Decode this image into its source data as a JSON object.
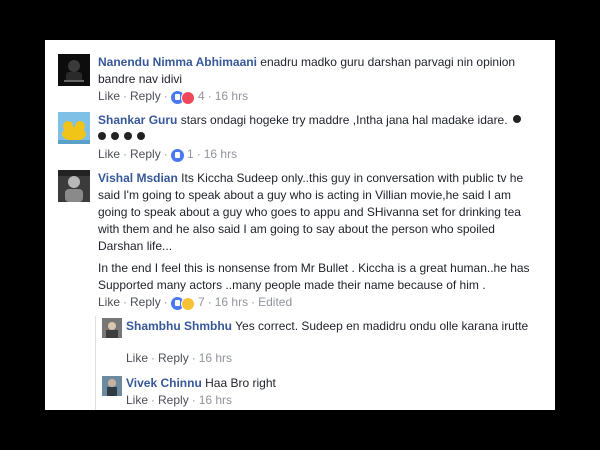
{
  "comments": [
    {
      "author": "Nanendu Nimma Abhimaani",
      "text": "enadru madko guru darshan parvagi nin opinion bandre nav idivi",
      "actions": {
        "like": "Like",
        "reply": "Reply",
        "reactions": "4",
        "time": "16 hrs"
      },
      "reaction_icons": [
        "like-icon",
        "love-icon"
      ]
    },
    {
      "author": "Shankar Guru",
      "text": "stars ondagi hogeke try maddre ,Intha jana hal madake idare.",
      "actions": {
        "like": "Like",
        "reply": "Reply",
        "reactions": "1",
        "time": "16 hrs"
      },
      "reaction_icons": [
        "like-icon"
      ]
    },
    {
      "author": "Vishal Msdian",
      "text": "Its Kiccha Sudeep only..this guy in conversation with public tv he said I'm going to speak about a guy who is acting in Villian movie,he said I am going to speak about a guy who goes to appu and SHivanna set for drinking tea with them and he also said I am going to say about the person who spoiled Darshan life...",
      "text2": "In the end I feel this is nonsense from Mr Bullet . Kiccha is a great human..he has Supported many actors ..many people made their name because of him .",
      "actions": {
        "like": "Like",
        "reply": "Reply",
        "reactions": "7",
        "time": "16 hrs",
        "edited": "Edited"
      },
      "reaction_icons": [
        "like-icon",
        "haha-icon"
      ]
    }
  ],
  "replies": [
    {
      "author": "Shambhu Shmbhu",
      "text": "Yes correct. Sudeep en madidru ondu olle karana irutte",
      "actions": {
        "like": "Like",
        "reply": "Reply",
        "time": "16 hrs"
      }
    },
    {
      "author": "Vivek Chinnu",
      "text": "Haa Bro right",
      "actions": {
        "like": "Like",
        "reply": "Reply",
        "time": "16 hrs"
      }
    }
  ],
  "colors": {
    "name": "#365899",
    "text": "#1d2129",
    "meta": "#90949c",
    "like": "#4a78f0"
  }
}
